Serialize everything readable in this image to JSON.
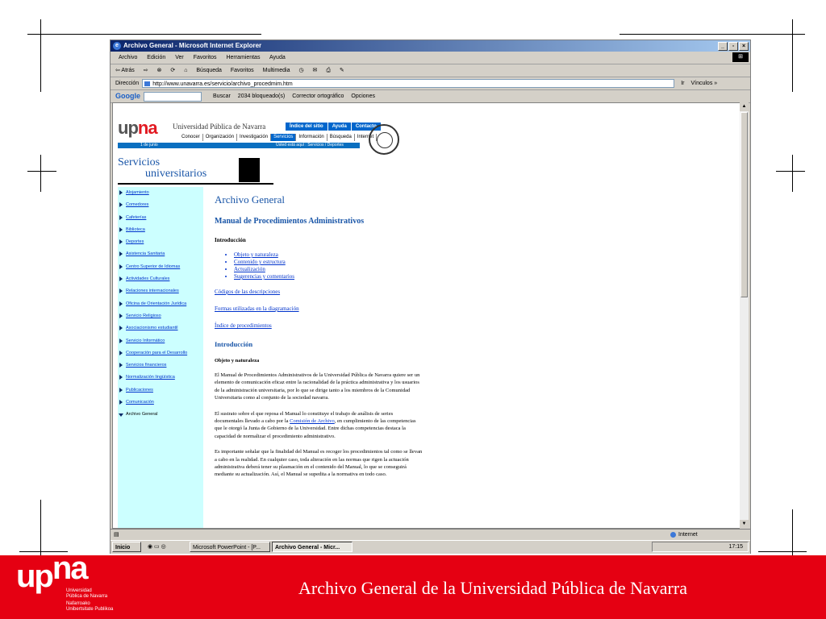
{
  "window": {
    "title": "Archivo General - Microsoft Internet Explorer",
    "buttons": [
      "_",
      "▫",
      "×"
    ]
  },
  "menubar": [
    "Archivo",
    "Edición",
    "Ver",
    "Favoritos",
    "Herramientas",
    "Ayuda"
  ],
  "toolbar": {
    "back": "⇦ Atrás",
    "fwd": "⇨",
    "search": "Búsqueda",
    "favorites": "Favoritos",
    "multimedia": "Multimedia"
  },
  "address": {
    "label": "Dirección",
    "url": "http://www.unavarra.es/servicio/archivo_procedmim.htm",
    "go": "Ir",
    "links": "Vínculos »"
  },
  "google_bar": {
    "logo": "Google",
    "buscar": "Buscar",
    "blocked": "2034 bloqueado(s)",
    "corrector": "Corrector ortográfico",
    "opciones": "Opciones"
  },
  "header": {
    "logo_u": "up",
    "logo_na": "na",
    "uni_name": "Universidad Pública de Navarra",
    "nav_top": [
      "Índice del sitio",
      "Ayuda",
      "Contacto"
    ],
    "nav_mid": [
      "Conocer",
      "Organización",
      "Investigación",
      "Servicios",
      "Información",
      "Búsqueda",
      "Internet"
    ],
    "date": "1 de junio",
    "breadcrumb": "Usted está aquí : Servicios / Deportes"
  },
  "section": {
    "line1": "Servicios",
    "line2": "universitarios"
  },
  "sidebar": {
    "items": [
      "Alojamiento",
      "Comedores",
      "Cafeterías",
      "Biblioteca",
      "Deportes",
      "Asistencia Sanitaria",
      "Centro Superior de Idiomas",
      "Actividades Culturales",
      "Relaciones internacionales",
      "Oficina de Orientación Jurídica",
      "Servicio Religioso",
      "Asociacionismo estudiantil",
      "Servicio Informático",
      "Cooperación para el Desarrollo",
      "Servicios financieros",
      "Normalización lingüística",
      "Publicaciones",
      "Comunicación",
      "Archivo General"
    ]
  },
  "main": {
    "title": "Archivo General",
    "subtitle": "Manual de Procedimientos Administrativos",
    "intro_heading": "Introducción",
    "intro_links": [
      "Objeto y naturaleza",
      "Contenido y estructura",
      "Actualización",
      "Sugerencias y comentarios"
    ],
    "link_codigos": "Códigos de las descripciones",
    "link_formas": "Formas utilizadas en la diagramación",
    "link_indice": "Índice de procedimientos",
    "section_heading": "Introducción",
    "sub_heading": "Objeto y naturaleza",
    "para1": "El Manual de Procedimientos Administrativos de la Universidad Pública de Navarra quiere ser un elemento de comunicación eficaz entre la racionalidad de la práctica administrativa y los usuarios de la administración universitaria, por lo que se dirige tanto a los miembros de la Comunidad Universitaria como al conjunto de la sociedad navarra.",
    "para2_a": "El sustrato sobre el que reposa el Manual lo constituye el trabajo de análisis de series documentales llevado a cabo por la ",
    "para2_link": "Comisión de Archivo",
    "para2_b": ", en cumplimiento de las competencias que le otorgó la Junta de Gobierno de la Universidad. Entre dichas competencias destaca la capacidad de normalizar el procedimiento administrativo.",
    "para3": "Es importante señalar que la finalidad del Manual es recoger los procedimientos tal como se llevan a cabo en la realidad. En cualquier caso, toda alteración en las normas que rigen la actuación administrativa deberá tener su plasmación en el contenido del Manual, lo que se conseguirá mediante su actualización. Así, el Manual se supedita a la normativa en todo caso."
  },
  "status": {
    "zone": "Internet"
  },
  "taskbar": {
    "start": "Inicio",
    "btn1": "Microsoft PowerPoint - [P...",
    "btn2": "Archivo General - Micr...",
    "clock": "17:15"
  },
  "footer": {
    "logo_u": "up",
    "logo_na": "na",
    "sub1": "Universidad",
    "sub2": "Pública de Navarra",
    "sub3": "Nafarroako",
    "sub4": "Unibertsitate Publikoa",
    "title": "Archivo General de la Universidad Pública de Navarra"
  },
  "colors": {
    "footer_red": "#e50012",
    "sidebar_cyan": "#ccffff",
    "nav_blue": "#0066cc"
  }
}
